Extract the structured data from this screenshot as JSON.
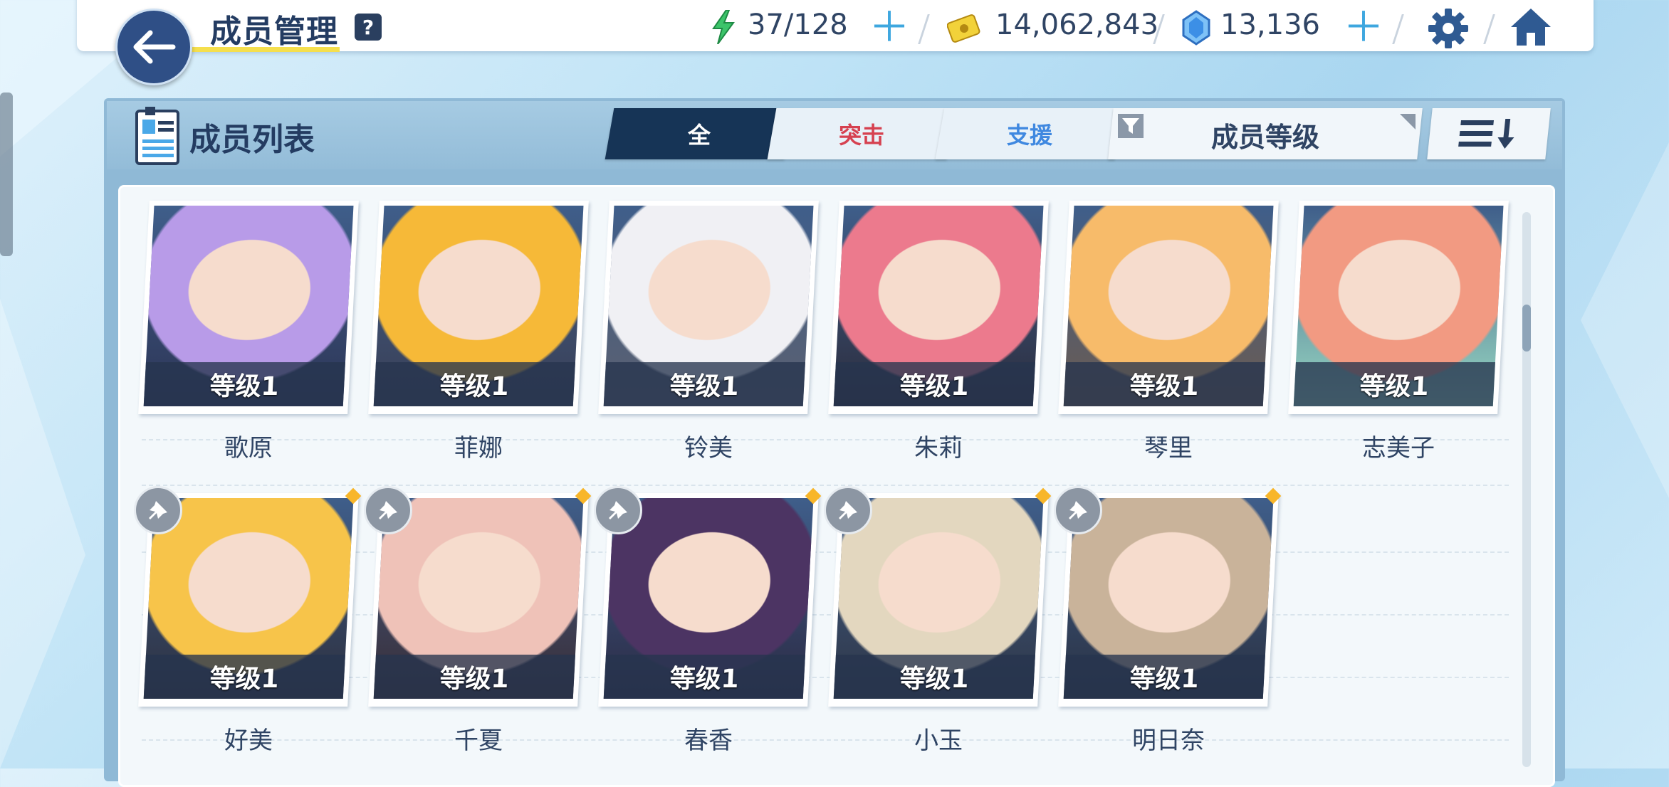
{
  "header": {
    "title": "成员管理",
    "help": "?",
    "ap": "37/128",
    "credits": "14,062,843",
    "gems": "13,136"
  },
  "panel": {
    "title": "成员列表",
    "tabs": [
      "全",
      "突击",
      "支援"
    ],
    "sort_label": "成员等级"
  },
  "students": [
    {
      "name": "歌原",
      "level": "等级1",
      "colors": [
        "#b89be8",
        "#2d3556"
      ]
    },
    {
      "name": "菲娜",
      "level": "等级1",
      "colors": [
        "#f6b938",
        "#3a3f55"
      ]
    },
    {
      "name": "铃美",
      "level": "等级1",
      "colors": [
        "#f0f0f4",
        "#5c6170"
      ]
    },
    {
      "name": "朱莉",
      "level": "等级1",
      "colors": [
        "#ec7a8d",
        "#2c2c3c"
      ]
    },
    {
      "name": "琴里",
      "level": "等级1",
      "colors": [
        "#f7bb6a",
        "#6c5b50"
      ]
    },
    {
      "name": "志美子",
      "level": "等级1",
      "colors": [
        "#f29a82",
        "#98d8c2"
      ]
    },
    {
      "name": "好美",
      "level": "等级1",
      "colors": [
        "#f7c44a",
        "#2d2f3d"
      ]
    },
    {
      "name": "千夏",
      "level": "等级1",
      "colors": [
        "#efc2b8",
        "#3a2c34"
      ]
    },
    {
      "name": "春香",
      "level": "等级1",
      "colors": [
        "#4c3463",
        "#2b2a44"
      ]
    },
    {
      "name": "小玉",
      "level": "等级1",
      "colors": [
        "#e3d7bf",
        "#2f3646"
      ]
    },
    {
      "name": "明日奈",
      "level": "等级1",
      "colors": [
        "#c9b39a",
        "#2a3142"
      ]
    }
  ],
  "colors": {
    "accent_dark": "#163456",
    "strike": "#d64150",
    "support": "#3f88e0",
    "plus": "#3ea7df",
    "energy": "#3cc46a",
    "credit": "#f2d23a",
    "gem": "#3c8fe6"
  },
  "icons": [
    "back-arrow-icon",
    "help-icon",
    "energy-icon",
    "plus-icon",
    "credit-icon",
    "gem-icon",
    "gear-icon",
    "home-icon",
    "member-list-icon",
    "filter-icon",
    "sort-order-icon",
    "pin-icon"
  ]
}
